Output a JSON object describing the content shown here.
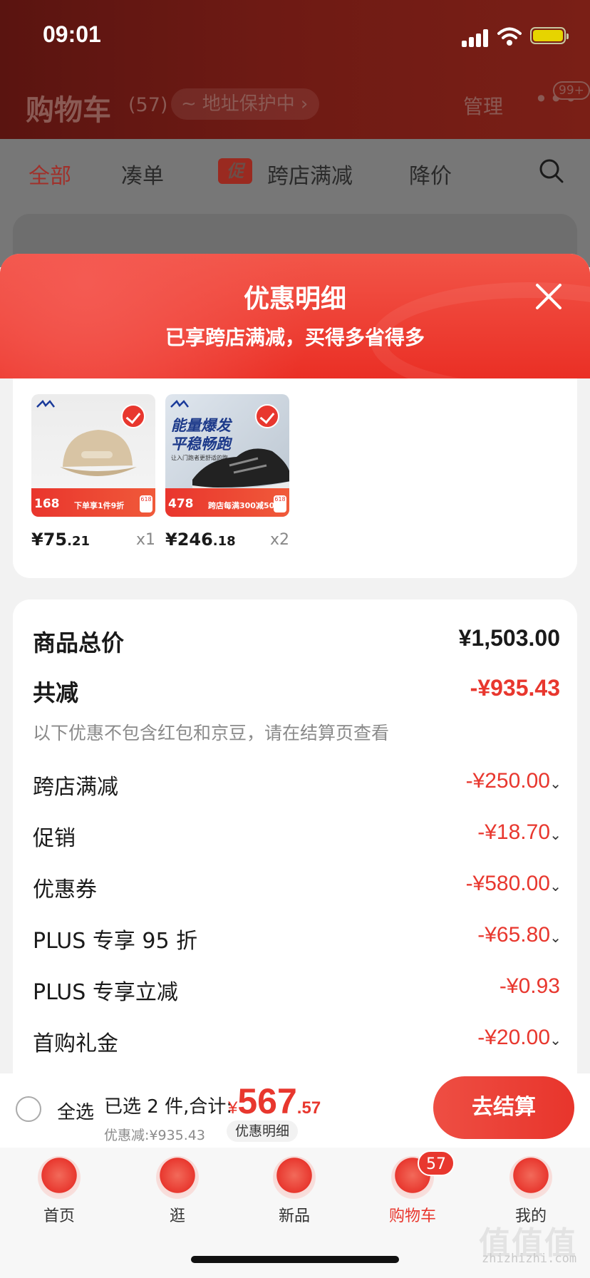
{
  "status_bar": {
    "time": "09:01"
  },
  "background": {
    "title": "购物车",
    "count": "(57)",
    "address_pill": "地址保护中",
    "manage": "管理",
    "more_badge": "99+",
    "filters": [
      {
        "label": "全部",
        "active": true
      },
      {
        "label": "凑单",
        "active": false
      },
      {
        "label": "跨店满减",
        "active": false,
        "tag": "促"
      },
      {
        "label": "降价",
        "active": false
      }
    ]
  },
  "sheet": {
    "title": "优惠明细",
    "subtitle": "已享跨店满减，买得多省得多",
    "products": [
      {
        "name": "cap",
        "price_int": "¥75",
        "price_dec": ".21",
        "qty": "x1",
        "promo_price": "168",
        "promo_text": "下单享1件9折",
        "checked": true
      },
      {
        "name": "shoe",
        "price_int": "¥246",
        "price_dec": ".18",
        "qty": "x2",
        "promo_price": "478",
        "promo_text": "跨店每满300减50",
        "image_line1": "能量爆发",
        "image_line2": "平稳畅跑",
        "image_line3": "让入门跑者更舒适的跑",
        "checked": true
      }
    ],
    "summary": {
      "total_label": "商品总价",
      "total_value": "¥1,503.00",
      "reduce_label": "共减",
      "reduce_value": "-¥935.43",
      "note": "以下优惠不包含红包和京豆，请在结算页查看",
      "items": [
        {
          "label": "跨店满减",
          "value": "-¥250.00",
          "expandable": true
        },
        {
          "label": "促销",
          "value": "-¥18.70",
          "expandable": true
        },
        {
          "label": "优惠券",
          "value": "-¥580.00",
          "expandable": true
        },
        {
          "label": "PLUS 专享 95 折",
          "value": "-¥65.80",
          "expandable": true
        },
        {
          "label": "PLUS 专享立减",
          "value": "-¥0.93",
          "expandable": false
        },
        {
          "label": "首购礼金",
          "value": "-¥20.00",
          "expandable": true
        }
      ]
    }
  },
  "bottom_bar": {
    "select_all": "全选",
    "selected_text": "已选 2 件,合计:",
    "price_currency": "¥",
    "price_int": "567",
    "price_dec": ".57",
    "discount_text": "优惠减:¥935.43",
    "detail_link": "优惠明细",
    "checkout": "去结算"
  },
  "tab_bar": {
    "tabs": [
      {
        "label": "首页",
        "icon": "home-icon"
      },
      {
        "label": "逛",
        "icon": "explore-icon"
      },
      {
        "label": "新品",
        "icon": "new-icon"
      },
      {
        "label": "购物车",
        "icon": "cart-icon",
        "active": true
      },
      {
        "label": "我的",
        "icon": "profile-icon"
      }
    ],
    "cart_badge": "57"
  },
  "watermark": {
    "text": "zhizhizhi.com",
    "big": "值值值"
  },
  "colors": {
    "accent": "#e8372e",
    "header_dark": "#6e1a14"
  }
}
